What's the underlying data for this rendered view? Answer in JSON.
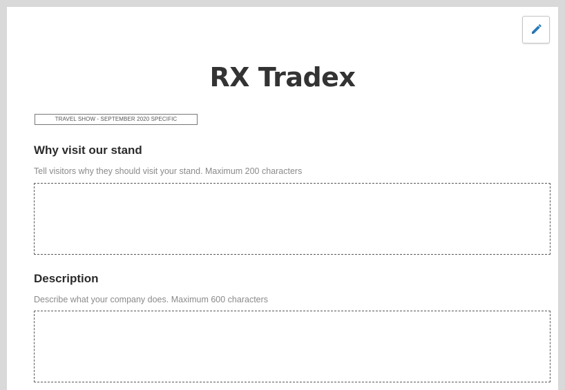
{
  "header": {
    "title": "RX Tradex",
    "edit_icon": "pencil-icon"
  },
  "show_tag": "TRAVEL SHOW - SEPTEMBER 2020 SPECIFIC",
  "sections": [
    {
      "heading": "Why visit our stand",
      "hint": "Tell visitors why they should visit your stand. Maximum 200 characters",
      "value": ""
    },
    {
      "heading": "Description",
      "hint": "Describe what your company does. Maximum 600 characters",
      "value": ""
    }
  ],
  "colors": {
    "page_background": "#d9d9d9",
    "card_background": "#ffffff",
    "title_text": "#333333",
    "hint_text": "#8a8a8a",
    "pencil_accent": "#2a7ab8"
  }
}
